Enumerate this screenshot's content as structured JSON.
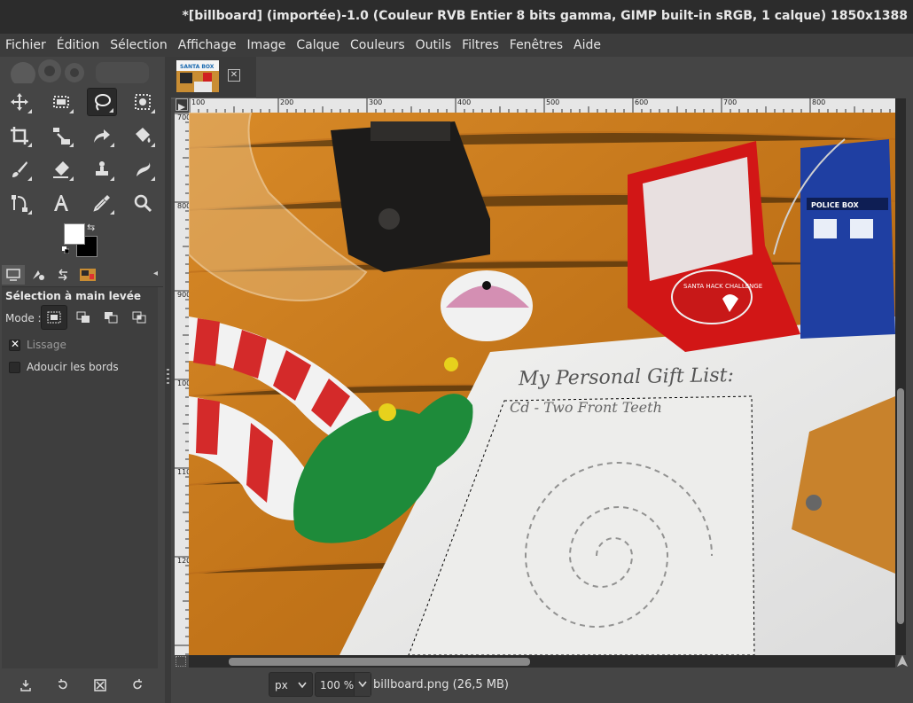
{
  "window": {
    "title": "*[billboard] (importée)-1.0 (Couleur RVB Entier 8 bits gamma, GIMP built-in sRGB, 1 calque) 1850x1388"
  },
  "menubar": {
    "items": [
      "Fichier",
      "Édition",
      "Sélection",
      "Affichage",
      "Image",
      "Calque",
      "Couleurs",
      "Outils",
      "Filtres",
      "Fenêtres",
      "Aide"
    ]
  },
  "toolbox": {
    "tools": [
      {
        "icon": "move-icon"
      },
      {
        "icon": "rect-select-icon"
      },
      {
        "icon": "lasso-icon",
        "active": true
      },
      {
        "icon": "fuzzy-select-icon"
      },
      {
        "icon": "crop-icon"
      },
      {
        "icon": "transform-icon"
      },
      {
        "icon": "warp-icon"
      },
      {
        "icon": "bucket-fill-icon"
      },
      {
        "icon": "paintbrush-icon"
      },
      {
        "icon": "eraser-icon"
      },
      {
        "icon": "clone-icon"
      },
      {
        "icon": "smudge-icon"
      },
      {
        "icon": "paths-icon"
      },
      {
        "icon": "text-icon"
      },
      {
        "icon": "color-picker-icon"
      },
      {
        "icon": "zoom-icon"
      }
    ],
    "fg_color": "#ffffff",
    "bg_color": "#000000"
  },
  "tool_options": {
    "heading": "Sélection à main levée",
    "mode_label": "Mode :",
    "antialias_label": "Lissage",
    "antialias_checked": true,
    "feather_label": "Adoucir les bords",
    "feather_checked": false
  },
  "image_tab": {
    "thumb_text": "SANTA BOX"
  },
  "ruler": {
    "h_labels": [
      "100",
      "200",
      "300",
      "400",
      "500",
      "600",
      "700",
      "800"
    ],
    "v_labels": [
      "700",
      "800",
      "900",
      "1000",
      "1100",
      "1200"
    ]
  },
  "canvas": {
    "gift_list_title": "My Personal Gift List:",
    "gift_line_1": "Cd - Two Front Teeth",
    "tardis_label": "POLICE BOX",
    "coin_text": "SANTA HACK CHALLENGE"
  },
  "statusbar": {
    "unit": "px",
    "zoom": "100 %",
    "file_info": "billboard.png (26,5 MB)"
  },
  "colors": {
    "accent": "#ffffff",
    "panel": "#454545",
    "titlebar": "#2c2c2c"
  }
}
